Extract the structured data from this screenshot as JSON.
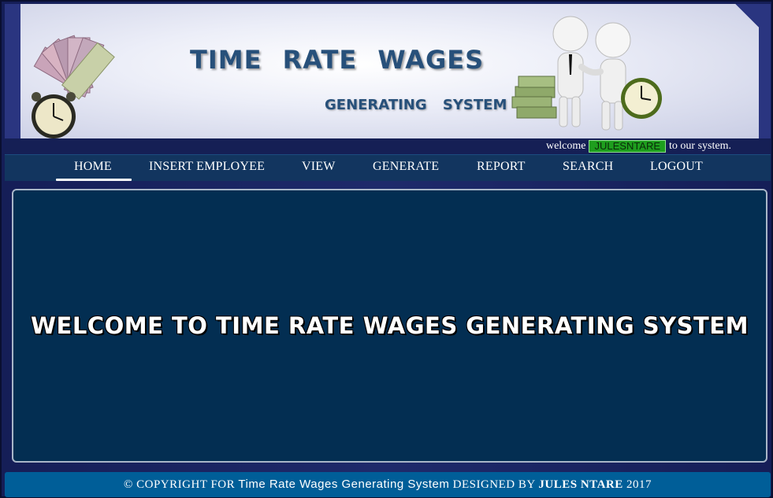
{
  "header": {
    "title": "TIME RATE WAGES",
    "subtitle": "GENERATING SYSTEM"
  },
  "welcome": {
    "prefix": "welcome",
    "username": "JULESNTARE",
    "suffix": "to our system."
  },
  "nav": {
    "items": [
      {
        "label": "HOME",
        "active": true
      },
      {
        "label": "INSERT EMPLOYEE"
      },
      {
        "label": "VIEW"
      },
      {
        "label": "GENERATE"
      },
      {
        "label": "REPORT"
      },
      {
        "label": "SEARCH"
      },
      {
        "label": "LOGOUT"
      }
    ]
  },
  "main": {
    "heading": "WELCOME TO TIME RATE WAGES GENERATING SYSTEM"
  },
  "footer": {
    "copyright": "© COPYRIGHT FOR",
    "app_name": "Time Rate Wages Generating System",
    "designed_by": "DESIGNED BY",
    "author": "JULES NTARE",
    "year": "2017"
  },
  "colors": {
    "banner_title": "#27507a",
    "nav_background": "#12355f",
    "main_background": "#032e52",
    "footer_background": "#005e98",
    "username_badge": "#1e9e1e"
  },
  "icons": [
    "money-clock-icon",
    "handshake-icon"
  ]
}
